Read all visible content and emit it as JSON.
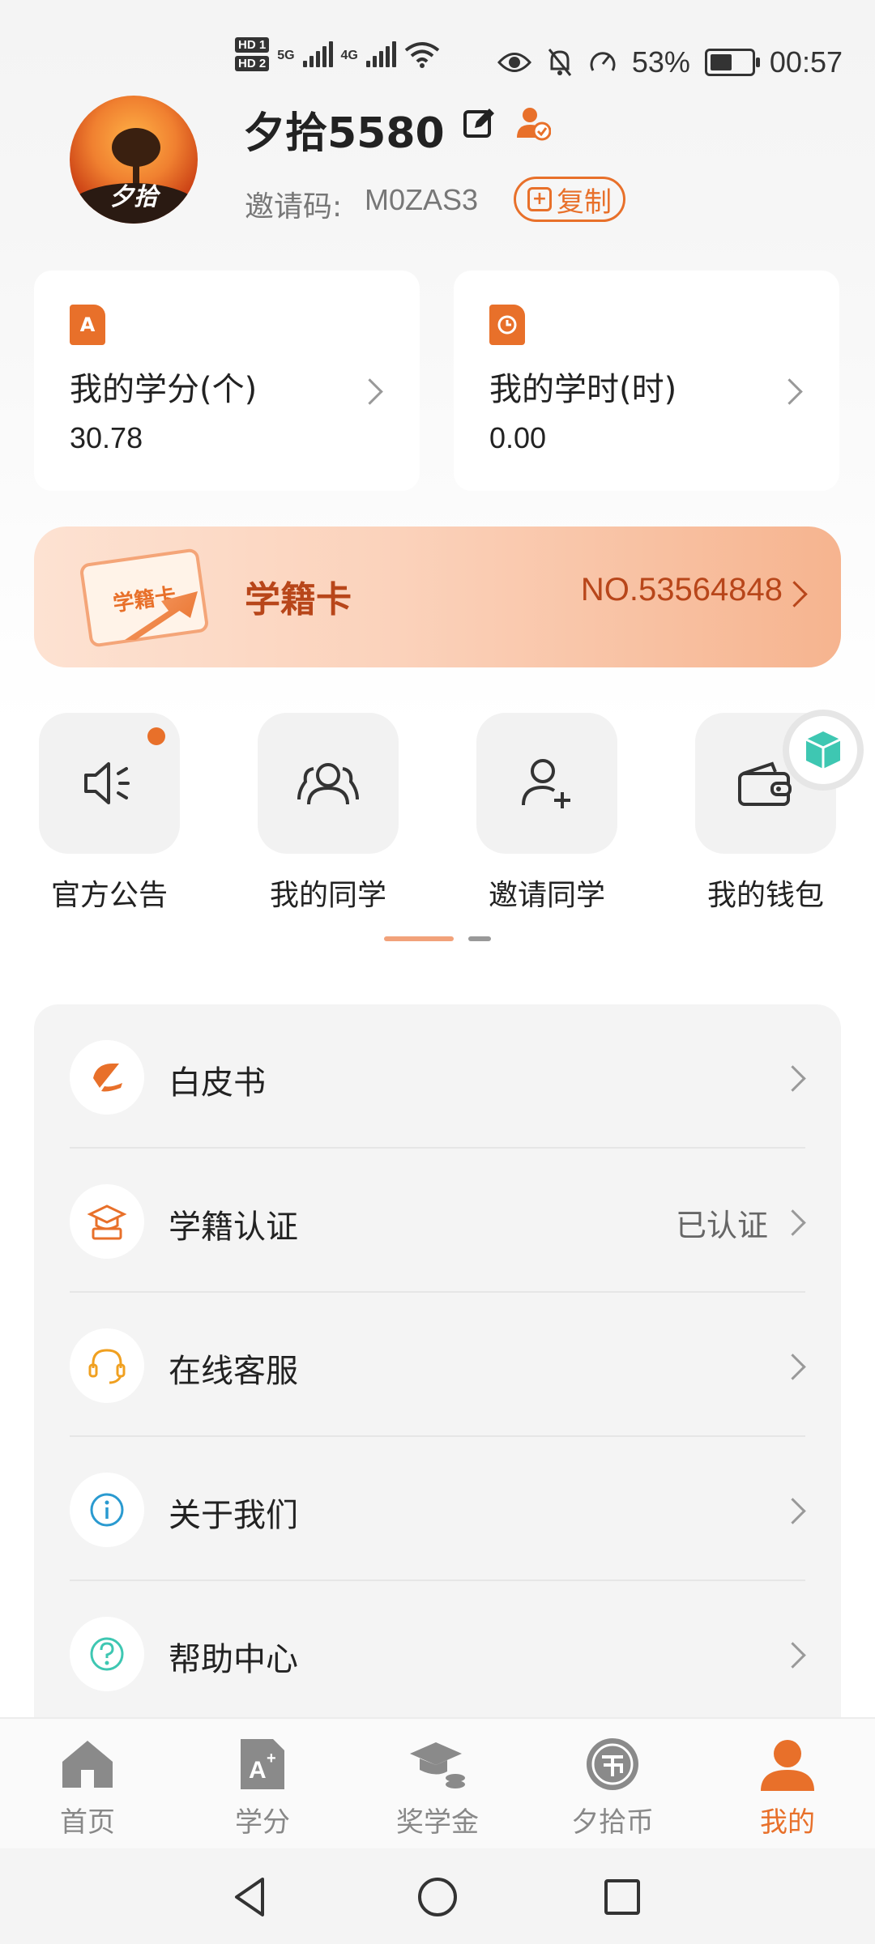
{
  "status_bar": {
    "hd1": "HD 1",
    "hd2": "HD 2",
    "net1": "5G",
    "net2": "4G",
    "battery_percent": "53%",
    "time": "00:57"
  },
  "profile": {
    "avatar_text": "夕拾",
    "username": "夕拾5580",
    "invite_label": "邀请码:",
    "invite_code": "M0ZAS3",
    "copy_label": "复制"
  },
  "stats": [
    {
      "title": "我的学分(个)",
      "value": "30.78",
      "icon": "credit-icon"
    },
    {
      "title": "我的学时(时)",
      "value": "0.00",
      "icon": "clock-icon"
    }
  ],
  "student_card": {
    "art_text": "学籍卡",
    "title": "学籍卡",
    "number": "NO.53564848"
  },
  "quick_actions": [
    {
      "label": "官方公告",
      "icon": "speaker-icon",
      "badge": true
    },
    {
      "label": "我的同学",
      "icon": "classmates-icon",
      "badge": false
    },
    {
      "label": "邀请同学",
      "icon": "add-user-icon",
      "badge": false
    },
    {
      "label": "我的钱包",
      "icon": "wallet-icon",
      "badge": false
    }
  ],
  "menu": [
    {
      "label": "白皮书",
      "value": "",
      "icon": "whitepaper-icon"
    },
    {
      "label": "学籍认证",
      "value": "已认证",
      "icon": "graduation-cert-icon"
    },
    {
      "label": "在线客服",
      "value": "",
      "icon": "headset-icon"
    },
    {
      "label": "关于我们",
      "value": "",
      "icon": "info-icon"
    },
    {
      "label": "帮助中心",
      "value": "",
      "icon": "help-icon"
    }
  ],
  "tabbar": [
    {
      "label": "首页",
      "icon": "home-icon",
      "active": false
    },
    {
      "label": "学分",
      "icon": "credit-tab-icon",
      "active": false
    },
    {
      "label": "奖学金",
      "icon": "scholarship-icon",
      "active": false
    },
    {
      "label": "夕拾币",
      "icon": "coin-icon",
      "active": false
    },
    {
      "label": "我的",
      "icon": "profile-icon",
      "active": true
    }
  ],
  "colors": {
    "accent": "#e8702a",
    "banner_text": "#b8461a",
    "panel_bg": "#f4f4f4"
  }
}
